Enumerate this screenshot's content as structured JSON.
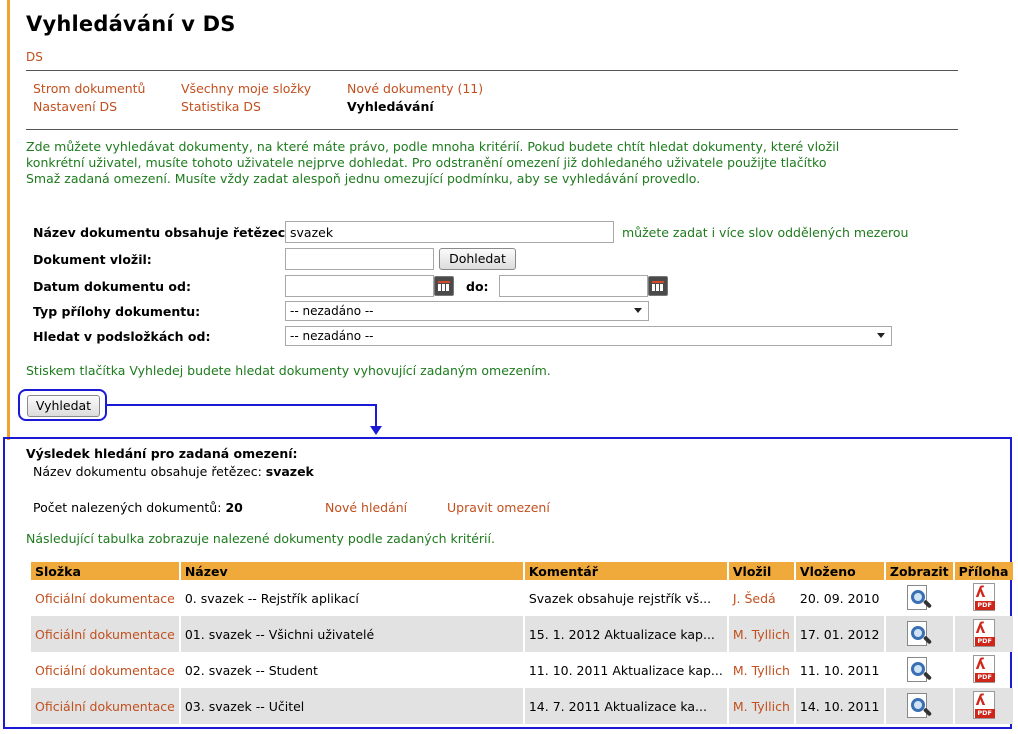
{
  "page": {
    "title": "Vyhledávání v DS",
    "breadcrumb": "DS"
  },
  "nav": {
    "row1": [
      "Strom dokumentů",
      "Všechny moje složky",
      "Nové dokumenty (11)"
    ],
    "row2": [
      "Nastavení DS",
      "Statistika DS",
      "Vyhledávání"
    ]
  },
  "intro": "Zde můžete vyhledávat dokumenty, na které máte právo, podle mnoha kritérií. Pokud budete chtít hledat dokumenty, které vložil konkrétní uživatel, musíte tohoto uživatele nejprve dohledat. Pro odstranění omezení již dohledaného uživatele použijte tlačítko Smaž zadaná omezení. Musíte vždy zadat alespoň jednu omezující podmínku, aby se vyhledávání provedlo.",
  "form": {
    "name_label": "Název dokumentu obsahuje řetězec:",
    "name_value": "svazek",
    "name_hint": "můžete zadat i více slov oddělených mezerou",
    "author_label": "Dokument vložil:",
    "author_value": "",
    "lookup_button": "Dohledat",
    "date_from_label": "Datum dokumentu od:",
    "date_to_label": "do:",
    "date_from_value": "",
    "date_to_value": "",
    "attachment_label": "Typ přílohy dokumentu:",
    "attachment_value": "-- nezadáno --",
    "subfolder_label": "Hledat v podsložkách od:",
    "subfolder_value": "-- nezadáno --",
    "help": "Stiskem tlačítka Vyhledej budete hledat dokumenty vyhovující zadaným omezením.",
    "search_button": "Vyhledat"
  },
  "results": {
    "heading": "Výsledek hledání pro zadaná omezení:",
    "criterion_label": "Název dokumentu obsahuje řetězec:",
    "criterion_value": "svazek",
    "count_label": "Počet nalezených dokumentů:",
    "count_value": "20",
    "new_search": "Nové hledání",
    "edit_criteria": "Upravit omezení",
    "table_note": "Následující tabulka zobrazuje nalezené dokumenty podle zadaných kritérií.",
    "columns": [
      "Složka",
      "Název",
      "Komentář",
      "Vložil",
      "Vloženo",
      "Zobrazit",
      "Příloha"
    ],
    "rows": [
      {
        "folder": "Oficiální dokumentace",
        "name": "0. svazek -- Rejstřík aplikací",
        "comment": "Svazek obsahuje rejstřík vš...",
        "author": "J. Šedá",
        "date": "20. 09. 2010"
      },
      {
        "folder": "Oficiální dokumentace",
        "name": "01. svazek -- Všichni uživatelé",
        "comment": "15. 1. 2012 Aktualizace kap...",
        "author": "M. Tyllich",
        "date": "17. 01. 2012"
      },
      {
        "folder": "Oficiální dokumentace",
        "name": "02. svazek -- Student",
        "comment": "11. 10. 2011 Aktualizace kap...",
        "author": "M. Tyllich",
        "date": "11. 10. 2011"
      },
      {
        "folder": "Oficiální dokumentace",
        "name": "03. svazek -- Učitel",
        "comment": "14. 7. 2011 Aktualizace ka...",
        "author": "M. Tyllich",
        "date": "14. 10. 2011"
      }
    ],
    "pdf_tag": "PDF"
  },
  "colors": {
    "accent": "#f0a22e",
    "link": "#c1501f",
    "help_text": "#1e7b1e",
    "annotation": "#1a1ad6"
  }
}
